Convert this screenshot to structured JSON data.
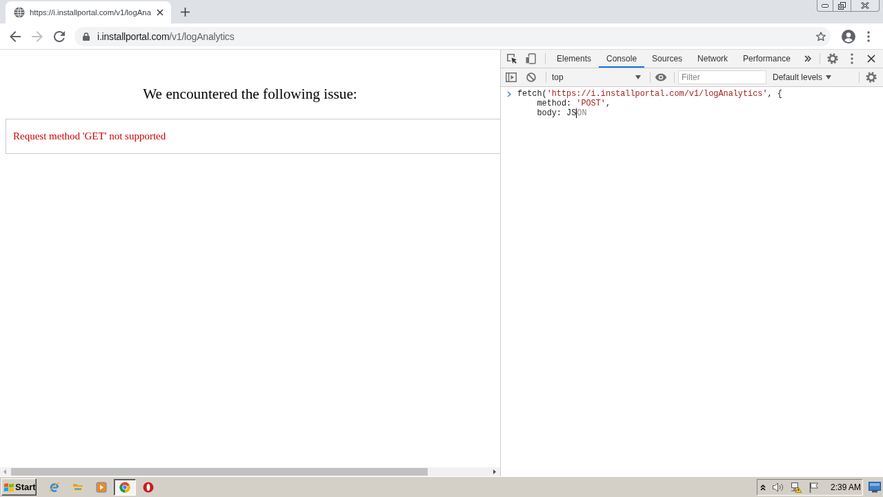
{
  "browser": {
    "tabs": [
      {
        "title": "https://i.installportal.com/v1/logAna",
        "selected": true
      }
    ],
    "nav_buttons": [
      {
        "kind": "back",
        "disabled": false
      },
      {
        "kind": "forward",
        "disabled": true
      },
      {
        "kind": "reload",
        "disabled": false
      }
    ],
    "address_bar": {
      "host": "i.installportal.com",
      "path": "/v1/logAnalytics"
    }
  },
  "page": {
    "heading": "We encountered the following issue:",
    "error_message": "Request method 'GET' not supported"
  },
  "devtools": {
    "tabs": [
      {
        "label": "Elements",
        "selected": false
      },
      {
        "label": "Console",
        "selected": true
      },
      {
        "label": "Sources",
        "selected": false
      },
      {
        "label": "Network",
        "selected": false
      },
      {
        "label": "Performance",
        "selected": false
      }
    ],
    "console_toolbar": {
      "context": "top",
      "filter": {
        "placeholder": "Filter"
      },
      "levels": "Default levels"
    },
    "console_input": [
      {
        "prompt": true,
        "indented": false,
        "tokens": [
          {
            "kind": "code",
            "text": "fetch("
          },
          {
            "kind": "string",
            "text": "'https://i.installportal.com/v1/logAnalytics'"
          },
          {
            "kind": "code",
            "text": ", {"
          }
        ]
      },
      {
        "prompt": false,
        "indented": true,
        "tokens": [
          {
            "kind": "code",
            "text": "method: "
          },
          {
            "kind": "string",
            "text": "'POST'"
          },
          {
            "kind": "code",
            "text": ","
          }
        ]
      },
      {
        "prompt": false,
        "indented": true,
        "tokens": [
          {
            "kind": "code",
            "text": "body: JS"
          },
          {
            "kind": "suggestion",
            "text": "ON"
          }
        ]
      }
    ]
  },
  "taskbar": {
    "start_label": "Start",
    "apps": [
      {
        "kind": "ie",
        "active": false
      },
      {
        "kind": "folder",
        "active": false
      },
      {
        "kind": "media",
        "active": false
      },
      {
        "kind": "chrome",
        "active": true
      },
      {
        "kind": "opera",
        "active": false
      }
    ],
    "clock": "2:39 AM"
  }
}
